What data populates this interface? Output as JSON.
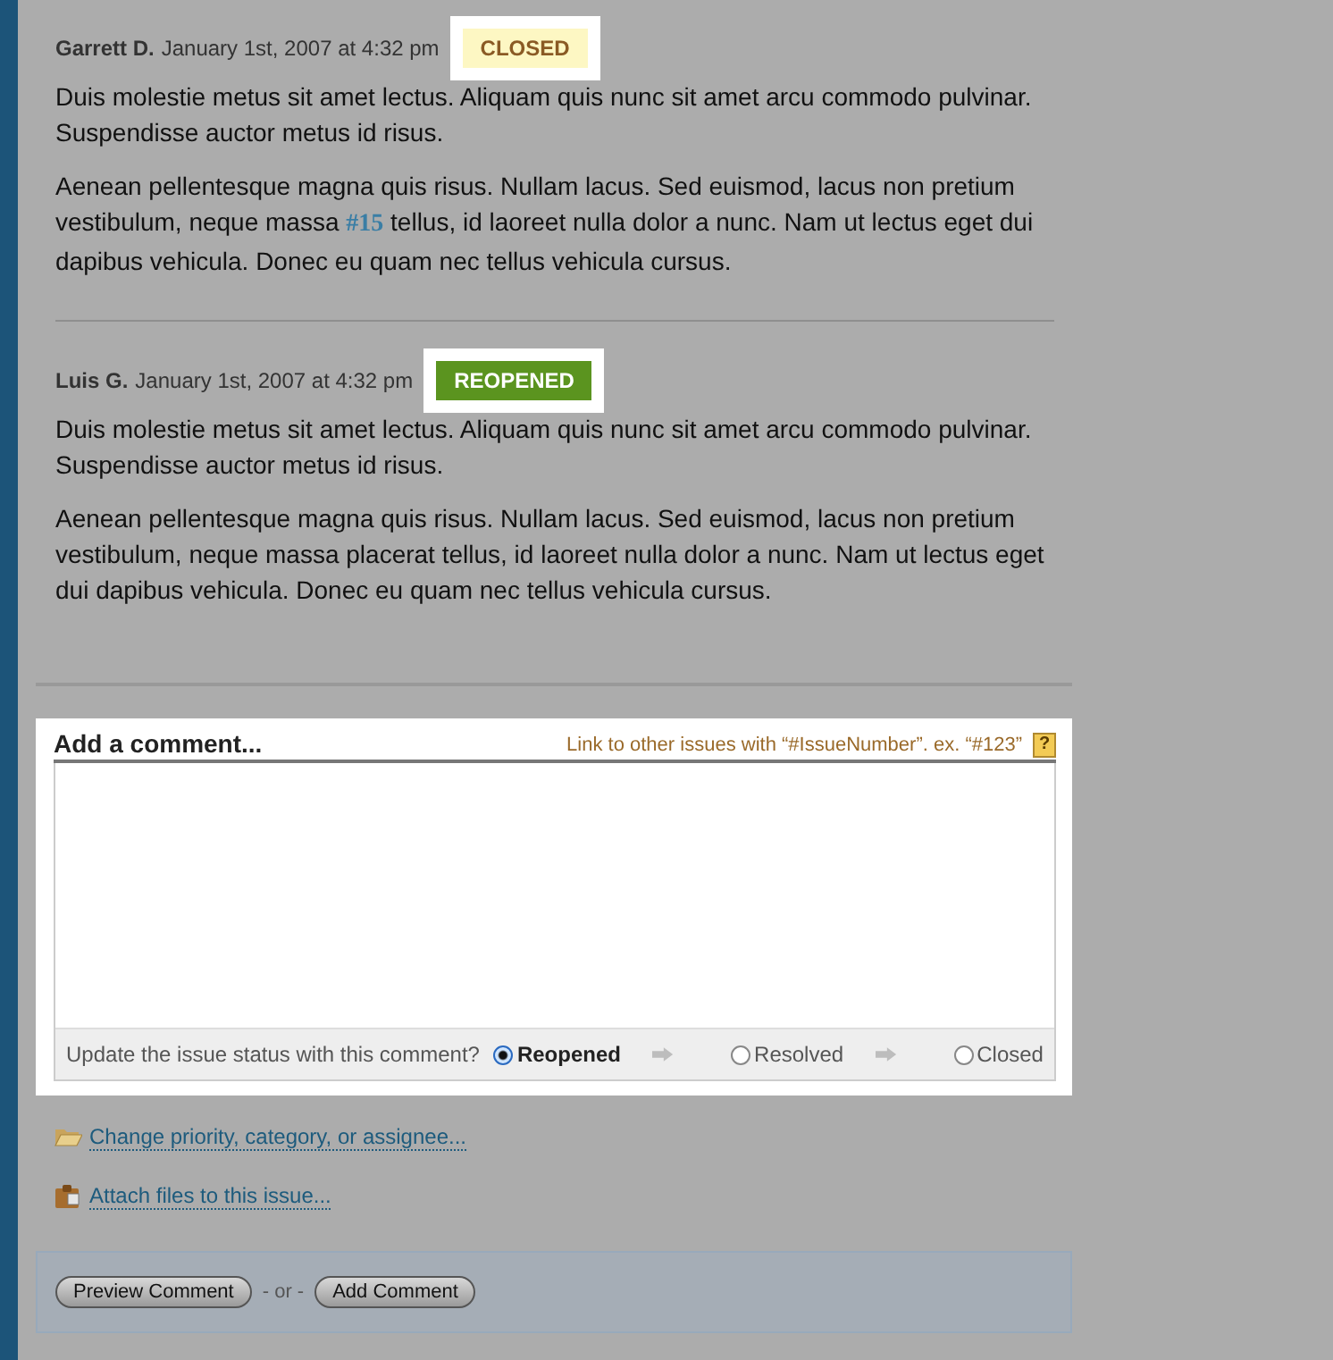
{
  "comments": [
    {
      "author": "Garrett D.",
      "date": "January 1st, 2007 at 4:32 pm",
      "status": {
        "kind": "closed",
        "label": "CLOSED"
      },
      "paragraphs": [
        [
          {
            "kind": "text",
            "text": "Duis molestie metus sit amet lectus. Aliquam quis nunc sit amet arcu commodo pulvinar. Suspendisse auctor metus id risus."
          }
        ],
        [
          {
            "kind": "text",
            "text": "Aenean pellentesque magna quis risus. Nullam lacus. Sed euismod, lacus non pretium vestibulum, neque massa "
          },
          {
            "kind": "issue_link",
            "text": "#15"
          },
          {
            "kind": "text",
            "text": " tellus, id laoreet nulla dolor a nunc. Nam ut lectus eget dui dapibus vehicula. Donec eu quam nec tellus vehicula cursus."
          }
        ]
      ]
    },
    {
      "author": "Luis G.",
      "date": "January 1st, 2007 at 4:32 pm",
      "status": {
        "kind": "reopened",
        "label": "REOPENED"
      },
      "paragraphs": [
        [
          {
            "kind": "text",
            "text": "Duis molestie metus sit amet lectus. Aliquam quis nunc sit amet arcu commodo pulvinar. Suspendisse auctor metus id risus."
          }
        ],
        [
          {
            "kind": "text",
            "text": "Aenean pellentesque magna quis risus. Nullam lacus. Sed euismod, lacus non pretium vestibulum, neque massa placerat tellus, id laoreet nulla dolor a nunc. Nam ut lectus eget dui dapibus vehicula. Donec eu quam nec tellus vehicula cursus."
          }
        ]
      ]
    }
  ],
  "comment_form": {
    "title": "Add a comment...",
    "hint": "Link to other issues with “#IssueNumber”. ex. “#123”",
    "help": "?",
    "status_prompt": "Update the issue status with this comment?",
    "status_options": [
      {
        "label": "Reopened",
        "selected": true
      },
      {
        "label": "Resolved",
        "selected": false
      },
      {
        "label": "Closed",
        "selected": false
      }
    ]
  },
  "links": [
    {
      "kind": "folder",
      "label": "Change priority, category, or assignee..."
    },
    {
      "kind": "attach",
      "label": "Attach files to this issue..."
    }
  ],
  "actions": {
    "preview": "Preview Comment",
    "separator": "- or -",
    "submit": "Add Comment"
  }
}
